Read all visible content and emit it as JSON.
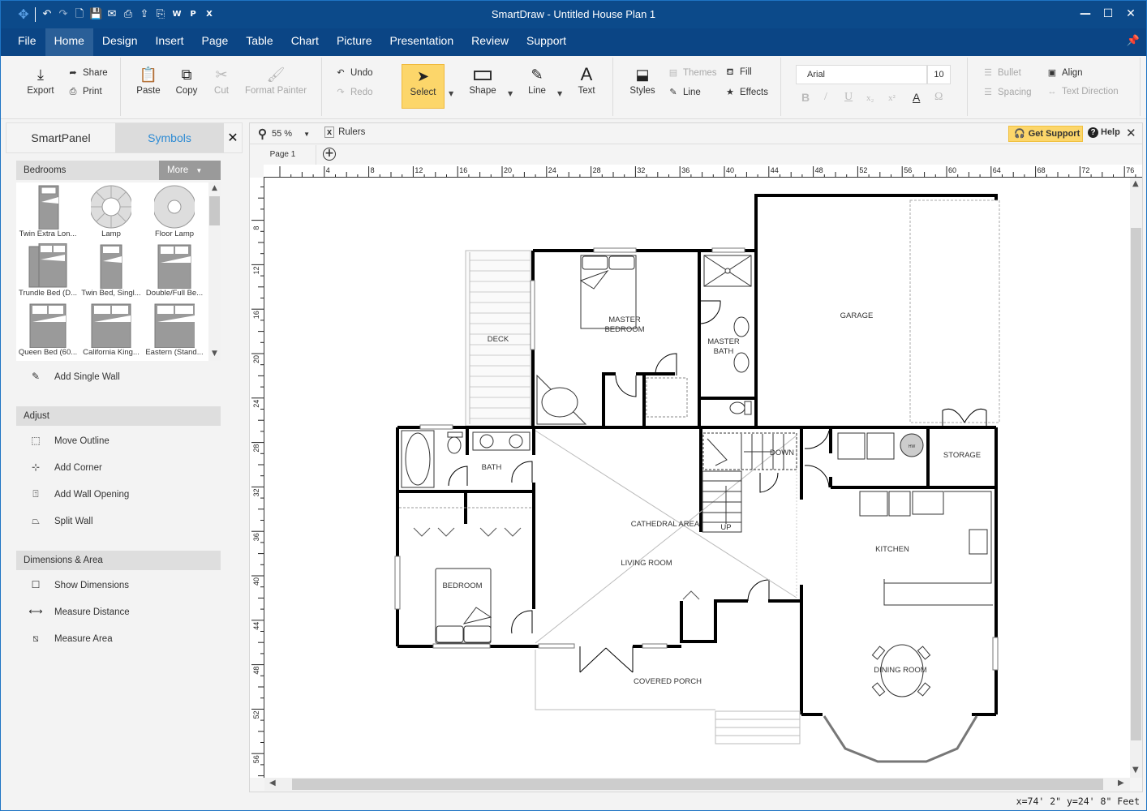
{
  "app": {
    "title": "SmartDraw - Untitled House Plan 1",
    "quick_access": [
      "app-logo",
      "undo",
      "redo",
      "new-document",
      "save",
      "email",
      "print",
      "share",
      "export-pdf",
      "export-word",
      "export-powerpoint",
      "export-excel"
    ],
    "window_controls": {
      "minimize": "—",
      "maximize": "☐",
      "close": "✕"
    }
  },
  "menu": {
    "items": [
      "File",
      "Home",
      "Design",
      "Insert",
      "Page",
      "Table",
      "Chart",
      "Picture",
      "Presentation",
      "Review",
      "Support"
    ],
    "active": "Home"
  },
  "ribbon": {
    "export": "Export",
    "share": "Share",
    "print": "Print",
    "paste": "Paste",
    "copy": "Copy",
    "cut": "Cut",
    "format_painter": "Format Painter",
    "undo": "Undo",
    "redo": "Redo",
    "select": "Select",
    "shape": "Shape",
    "line": "Line",
    "text": "Text",
    "styles": "Styles",
    "themes": "Themes",
    "line_style": "Line",
    "fill": "Fill",
    "effects": "Effects",
    "font_name": "Arial",
    "font_size": "10",
    "bold": "B",
    "italic": "/",
    "underline": "U",
    "subscript": "x₂",
    "superscript": "x²",
    "font_color": "A",
    "symbol": "Ω",
    "bullet": "Bullet",
    "spacing": "Spacing",
    "align": "Align",
    "text_direction": "Text Direction"
  },
  "left_panel": {
    "tabs": [
      "SmartPanel",
      "Symbols"
    ],
    "active_tab": "Symbols",
    "close": "✕",
    "library": {
      "name": "Bedrooms",
      "more_label": "More",
      "symbols": [
        "Twin Extra Lon...",
        "Lamp",
        "Floor Lamp",
        "Trundle Bed (D...",
        "Twin Bed, Singl...",
        "Double/Full Be...",
        "Queen Bed (60...",
        "California King...",
        "Eastern (Stand..."
      ]
    },
    "add_single_wall": "Add Single Wall",
    "adjust": {
      "header": "Adjust",
      "items": [
        "Move Outline",
        "Add Corner",
        "Add Wall Opening",
        "Split Wall"
      ]
    },
    "dimensions": {
      "header": "Dimensions & Area",
      "items": [
        "Show Dimensions",
        "Measure Distance",
        "Measure Area"
      ]
    }
  },
  "canvas": {
    "zoom": "55 %",
    "rulers_label": "Rulers",
    "get_support": "Get Support",
    "help": "Help",
    "page_tab": "Page 1",
    "hruler_ticks": [
      "4",
      "8",
      "12",
      "16",
      "20",
      "24",
      "28",
      "32",
      "36",
      "40",
      "44",
      "48",
      "52",
      "56",
      "60",
      "64",
      "68",
      "72",
      "76"
    ],
    "vruler_ticks": [
      "8",
      "12",
      "16",
      "20",
      "24",
      "28",
      "32",
      "36",
      "40",
      "44",
      "48",
      "52",
      "56"
    ],
    "rooms": {
      "deck": "DECK",
      "master_bedroom_1": "MASTER",
      "master_bedroom_2": "BEDROOM",
      "master_bath_1": "MASTER",
      "master_bath_2": "BATH",
      "garage": "GARAGE",
      "bath": "BATH",
      "down": "DOWN",
      "up": "UP",
      "hw": "HW",
      "storage": "STORAGE",
      "cathedral_area": "CATHEDRAL AREA",
      "living_room": "LIVING ROOM",
      "kitchen": "KITCHEN",
      "bedroom": "BEDROOM",
      "covered_porch": "COVERED PORCH",
      "dining_room": "DINING ROOM"
    }
  },
  "status": {
    "coordinates": "x=74' 2\"  y=24' 8\" Feet"
  }
}
